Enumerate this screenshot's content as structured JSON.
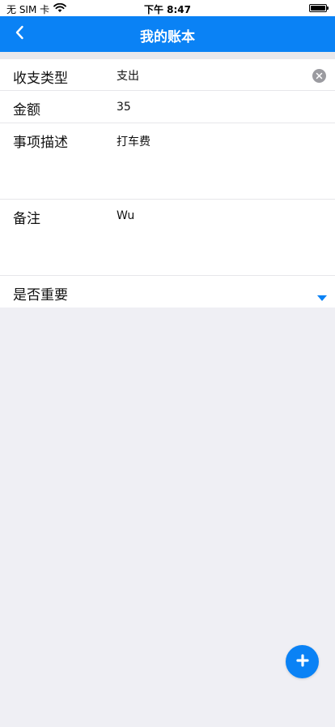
{
  "status_bar": {
    "carrier": "无 SIM 卡",
    "time": "下午 8:47"
  },
  "nav": {
    "title": "我的账本"
  },
  "form": {
    "type": {
      "label": "收支类型",
      "value": "支出"
    },
    "amount": {
      "label": "金额",
      "value": "35"
    },
    "description": {
      "label": "事项描述",
      "value": "打车费"
    },
    "note": {
      "label": "备注",
      "value": "Wu"
    },
    "important": {
      "label": "是否重要"
    }
  },
  "colors": {
    "accent": "#0a82f5",
    "background": "#efeff4",
    "clear_icon": "#9b9ba0"
  },
  "icons": [
    "wifi-icon",
    "battery-icon",
    "back-chevron-icon",
    "clear-icon",
    "dropdown-arrow-icon",
    "plus-icon"
  ]
}
